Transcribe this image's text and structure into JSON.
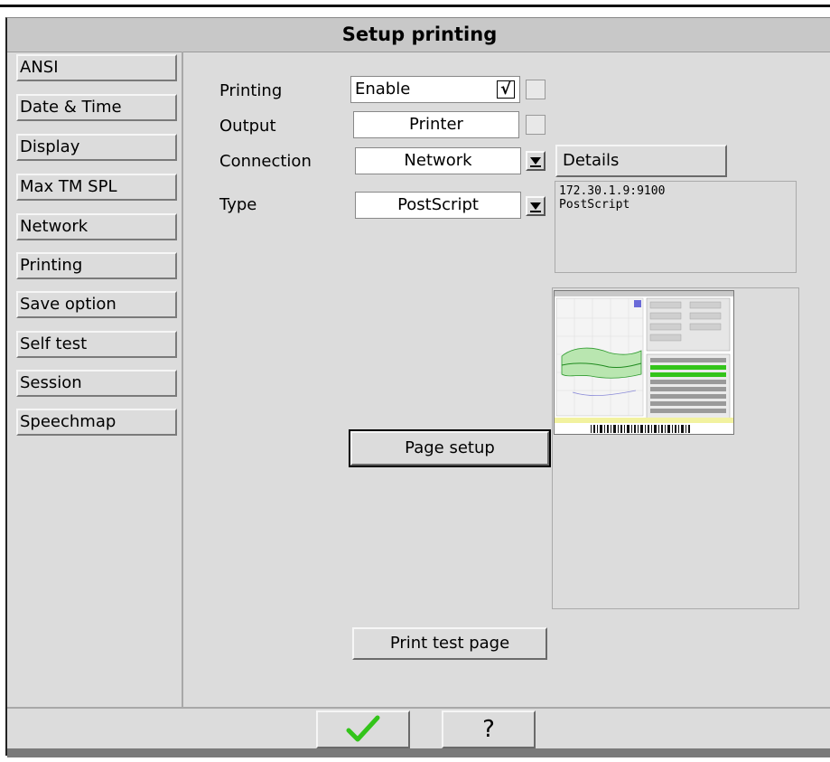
{
  "window": {
    "title": "Setup printing"
  },
  "sidebar": {
    "items": [
      {
        "label": "ANSI"
      },
      {
        "label": "Date & Time"
      },
      {
        "label": "Display"
      },
      {
        "label": "Max TM SPL"
      },
      {
        "label": "Network"
      },
      {
        "label": "Printing"
      },
      {
        "label": "Save option"
      },
      {
        "label": "Self test"
      },
      {
        "label": "Session"
      },
      {
        "label": "Speechmap"
      }
    ]
  },
  "form": {
    "printing_label": "Printing",
    "printing_value": "Enable",
    "printing_checked": "√",
    "output_label": "Output",
    "output_value": "Printer",
    "connection_label": "Connection",
    "connection_value": "Network",
    "type_label": "Type",
    "type_value": "PostScript",
    "details_button": "Details",
    "info_line1": "172.30.1.9:9100",
    "info_line2": "PostScript",
    "page_setup_button": "Page setup",
    "print_test_button": "Print test page"
  },
  "bottom": {
    "ok_icon": "green-checkmark-icon",
    "help_label": "?"
  },
  "colors": {
    "ok_green": "#33c41a",
    "background": "#dcdcdc",
    "title_bg": "#c8c8c8"
  }
}
